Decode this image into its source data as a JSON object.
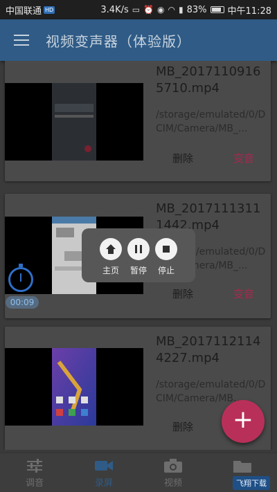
{
  "status_bar": {
    "carrier": "中国联通",
    "carrier_badge": "HD",
    "speed": "3.4K/s",
    "battery": "83%",
    "battery_level": 0.83,
    "time": "中午11:28"
  },
  "app": {
    "title": "视频变声器（体验版）"
  },
  "videos": [
    {
      "name": "MB_20171109165710.mp4",
      "path": "/storage/emulated/0/DCIM/Camera/MB_...",
      "delete_label": "删除",
      "voice_label": "变音"
    },
    {
      "name": "MB_20171113111442.mp4",
      "path": "/storage/emulated/0/DCIM/Camera/MB_...",
      "delete_label": "删除",
      "voice_label": "变音"
    },
    {
      "name": "MB_20171121144227.mp4",
      "path": "/storage/emulated/0/DCIM/Camera/MB...",
      "delete_label": "删除"
    }
  ],
  "recorder": {
    "timer": "00:09",
    "home_label": "主页",
    "pause_label": "暂停",
    "stop_label": "停止"
  },
  "fab": {
    "label": "+"
  },
  "bottom_nav": [
    {
      "label": "调音",
      "icon": "sliders-icon"
    },
    {
      "label": "录屏",
      "icon": "video-camera-icon",
      "active": true
    },
    {
      "label": "视频",
      "icon": "camera-icon"
    },
    {
      "label": "",
      "icon": "folder-icon"
    }
  ],
  "watermark": "飞翔下载"
}
